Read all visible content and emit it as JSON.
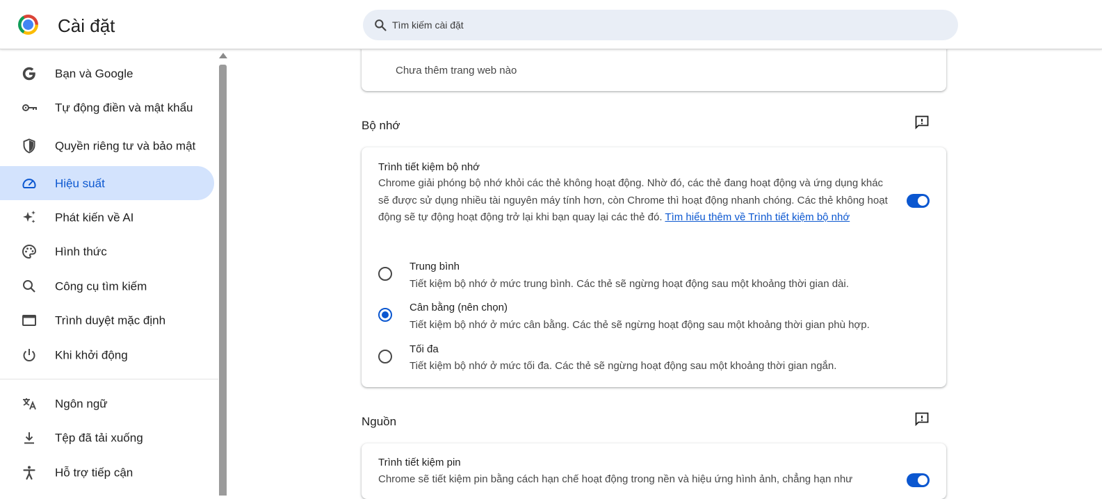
{
  "header": {
    "app_title": "Cài đặt",
    "search_placeholder": "Tìm kiếm cài đặt"
  },
  "sidebar": {
    "items": [
      {
        "label": "Bạn và Google",
        "icon": "google-icon"
      },
      {
        "label": "Tự động điền và mật khẩu",
        "icon": "key-icon"
      },
      {
        "label": "Quyền riêng tư và bảo mật",
        "icon": "shield-icon"
      },
      {
        "label": "Hiệu suất",
        "icon": "speedometer-icon",
        "active": true
      },
      {
        "label": "Phát kiến về AI",
        "icon": "sparkle-icon"
      },
      {
        "label": "Hình thức",
        "icon": "palette-icon"
      },
      {
        "label": "Công cụ tìm kiếm",
        "icon": "search-icon"
      },
      {
        "label": "Trình duyệt mặc định",
        "icon": "browser-window-icon"
      },
      {
        "label": "Khi khởi động",
        "icon": "power-icon"
      },
      {
        "label": "Ngôn ngữ",
        "icon": "translate-icon"
      },
      {
        "label": "Tệp đã tải xuống",
        "icon": "download-icon"
      },
      {
        "label": "Hỗ trợ tiếp cận",
        "icon": "accessibility-icon"
      }
    ]
  },
  "main": {
    "top_card": {
      "empty_text": "Chưa thêm trang web nào"
    },
    "memory": {
      "section_title": "Bộ nhớ",
      "saver_title": "Trình tiết kiệm bộ nhớ",
      "saver_desc": "Chrome giải phóng bộ nhớ khỏi các thẻ không hoạt động. Nhờ đó, các thẻ đang hoạt động và ứng dụng khác sẽ được sử dụng nhiều tài nguyên máy tính hơn, còn Chrome thì hoạt động nhanh chóng. Các thẻ không hoạt động sẽ tự động hoạt động trở lại khi bạn quay lại các thẻ đó.",
      "learn_more": "Tìm hiểu thêm về Trình tiết kiệm bộ nhớ",
      "toggle_on": true,
      "options": [
        {
          "title": "Trung bình",
          "desc": "Tiết kiệm bộ nhớ ở mức trung bình. Các thẻ sẽ ngừng hoạt động sau một khoảng thời gian dài.",
          "checked": false
        },
        {
          "title": "Cân bằng (nên chọn)",
          "desc": "Tiết kiệm bộ nhớ ở mức cân bằng. Các thẻ sẽ ngừng hoạt động sau một khoảng thời gian phù hợp.",
          "checked": true
        },
        {
          "title": "Tối đa",
          "desc": "Tiết kiệm bộ nhớ ở mức tối đa. Các thẻ sẽ ngừng hoạt động sau một khoảng thời gian ngắn.",
          "checked": false
        }
      ]
    },
    "power": {
      "section_title": "Nguồn",
      "saver_title": "Trình tiết kiệm pin",
      "saver_desc": "Chrome sẽ tiết kiệm pin bằng cách hạn chế hoạt động trong nền và hiệu ứng hình ảnh, chẳng hạn như",
      "toggle_on": true
    }
  },
  "colors": {
    "accent": "#0b57d0",
    "active_nav_bg": "#d3e3fd",
    "search_bg": "#e9eef6"
  }
}
